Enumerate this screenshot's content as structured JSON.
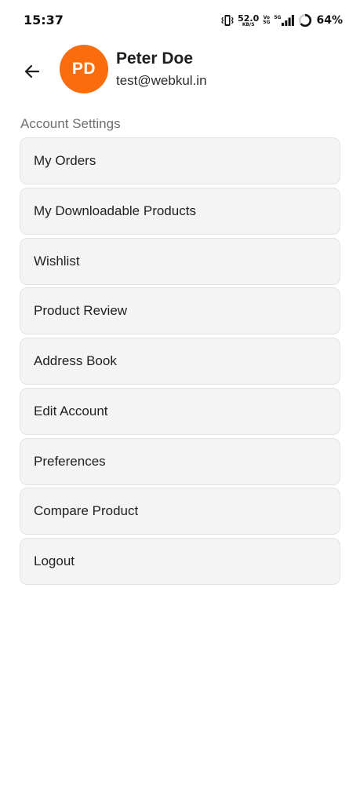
{
  "status_bar": {
    "time": "15:37",
    "net_speed_value": "52.0",
    "net_speed_unit": "KB/S",
    "volte_top": "Vo",
    "volte_bottom": "5G",
    "signal_tag": "5G",
    "battery_percent": "64%",
    "battery_level": 0.64
  },
  "header": {
    "back_icon": "arrow-back-icon",
    "avatar_initials": "PD",
    "avatar_color": "#fb6d0c",
    "user_name": "Peter Doe",
    "user_email": "test@webkul.in"
  },
  "account_settings": {
    "title": "Account Settings",
    "items": [
      {
        "label": "My Orders"
      },
      {
        "label": "My Downloadable Products"
      },
      {
        "label": "Wishlist"
      },
      {
        "label": "Product Review"
      },
      {
        "label": "Address Book"
      },
      {
        "label": "Edit Account"
      },
      {
        "label": "Preferences"
      },
      {
        "label": "Compare Product"
      },
      {
        "label": "Logout"
      }
    ]
  }
}
